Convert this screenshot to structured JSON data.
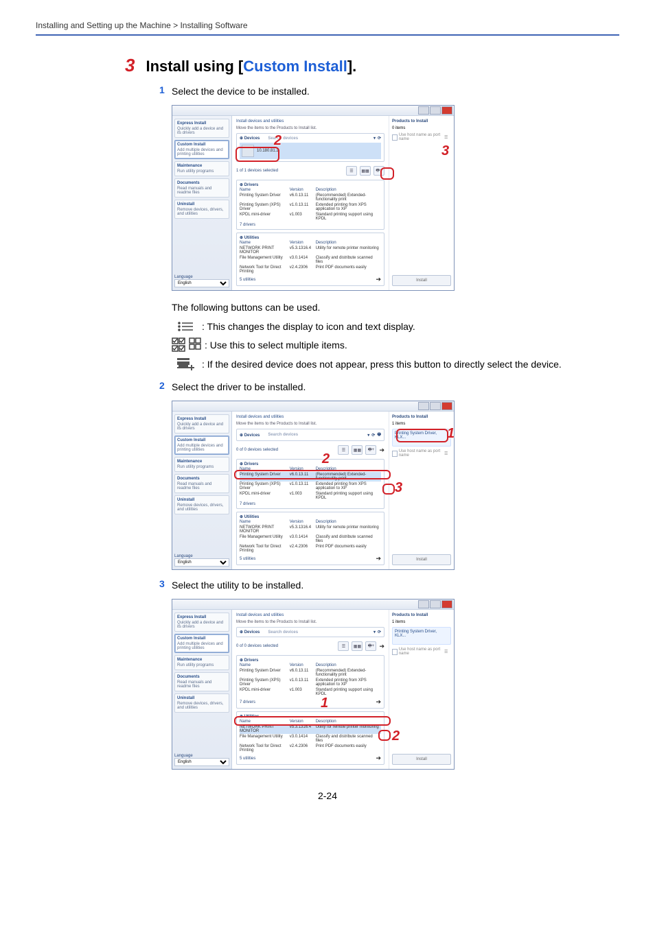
{
  "header": {
    "breadcrumb": "Installing and Setting up the Machine > Installing Software"
  },
  "section": {
    "number": "3",
    "title_pre": "Install using [",
    "title_link": "Custom Install",
    "title_post": "]."
  },
  "steps": {
    "s1": {
      "num": "1",
      "text": "Select the device to be installed."
    },
    "s2": {
      "num": "2",
      "text": "Select the driver to be installed."
    },
    "s3": {
      "num": "3",
      "text": "Select the utility to be installed."
    }
  },
  "notes": {
    "buttons_intro": "The following buttons can be used.",
    "icon_list": " : This changes the display to icon and text display.",
    "icon_multi": " : Use this to select multiple items.",
    "icon_add": " : If the desired device does not appear, press this button to directly select the device."
  },
  "sidebar": {
    "express": {
      "title": "Express Install",
      "sub": "Quickly add a device and its drivers"
    },
    "custom": {
      "title": "Custom Install",
      "sub": "Add multiple devices and printing utilities"
    },
    "maint": {
      "title": "Maintenance",
      "sub": "Run utility programs"
    },
    "docs": {
      "title": "Documents",
      "sub": "Read manuals and readme files"
    },
    "uninst": {
      "title": "Uninstall",
      "sub": "Remove devices, drivers, and utilities"
    },
    "lang_label": "Language",
    "lang_value": "English"
  },
  "installer": {
    "title": "Install devices and utilities",
    "subtitle": "Move the items to the Products to Install list.",
    "search_placeholder": "Search devices",
    "devices_panel": "Devices",
    "drivers_panel": "Drivers",
    "utilities_panel": "Utilities",
    "selected_0": "0 of 0 devices selected",
    "selected_1": "1 of 1 devices selected",
    "drivers_count": "7 drivers",
    "utilities_count": "5 utilities",
    "col_name": "Name",
    "col_version": "Version",
    "col_desc": "Description",
    "right_title": "Products to Install",
    "right_count0": "0 items",
    "right_count1": "1 items",
    "install_btn": "Install",
    "hostchk": "Use host name as port name",
    "device_name": "10.180.81.2",
    "drivers": [
      {
        "name": "Printing System Driver",
        "ver": "v6.0.13.11",
        "desc": "(Recommended) Extended-functionality print"
      },
      {
        "name": "Printing System (XPS) Driver",
        "ver": "v1.0.13.11",
        "desc": "Extended printing from XPS application to XP"
      },
      {
        "name": "KPDL mini-driver",
        "ver": "v1.003",
        "desc": "Standard printing support using KPDL"
      }
    ],
    "utilities": [
      {
        "name": "NETWORK PRINT MONITOR",
        "ver": "v5.3.1316.4",
        "desc": "Utility for remote printer monitoring"
      },
      {
        "name": "File Management Utility",
        "ver": "v3.0.1414",
        "desc": "Classify and distribute scanned files"
      },
      {
        "name": "Network Tool for Direct Printing",
        "ver": "v2.4.2306",
        "desc": "Print PDF documents easily"
      }
    ],
    "right_slot_label": "Printing System Driver, KLX..."
  },
  "callouts": {
    "c1": "1",
    "c2": "2",
    "c3": "3"
  },
  "footer": {
    "page": "2-24"
  }
}
